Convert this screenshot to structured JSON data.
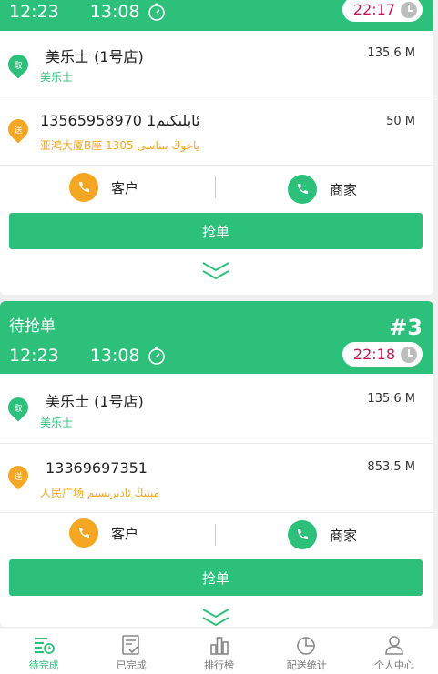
{
  "orders": [
    {
      "pickup_time": "12:23",
      "delivery_time": "13:08",
      "deadline": "22:17",
      "store_name": "美乐士 (1号店)",
      "store_sub": "美乐士",
      "store_distance": "135.6 M",
      "customer_phone": "13565958970 1ئابلىكىم",
      "customer_address": "亚鸿大厦B座 1305 ياخوڭ بىناسى",
      "customer_distance": "50 M",
      "pickup_badge": "取",
      "delivery_badge": "送",
      "customer_label": "客户",
      "merchant_label": "商家",
      "grab_label": "抢单"
    },
    {
      "status": "待抢单",
      "order_no": "#3",
      "pickup_time": "12:23",
      "delivery_time": "13:08",
      "deadline": "22:18",
      "store_name": "美乐士 (1号店)",
      "store_sub": "美乐士",
      "store_distance": "135.6 M",
      "customer_phone": "13369697351",
      "customer_address": "人民广场 مېنىڭ ئادىرىسىم",
      "customer_distance": "853.5 M",
      "pickup_badge": "取",
      "delivery_badge": "送",
      "customer_label": "客户",
      "merchant_label": "商家",
      "grab_label": "抢单"
    }
  ],
  "tabs": [
    {
      "label": "待完成",
      "icon": "list-clock-icon",
      "active": true
    },
    {
      "label": "已完成",
      "icon": "check-document-icon",
      "active": false
    },
    {
      "label": "排行榜",
      "icon": "bar-chart-icon",
      "active": false
    },
    {
      "label": "配送统计",
      "icon": "pie-chart-icon",
      "active": false
    },
    {
      "label": "个人中心",
      "icon": "person-icon",
      "active": false
    }
  ],
  "colors": {
    "accent": "#2dc07a",
    "orange": "#f5a623",
    "deadline_text": "#c2185b"
  }
}
